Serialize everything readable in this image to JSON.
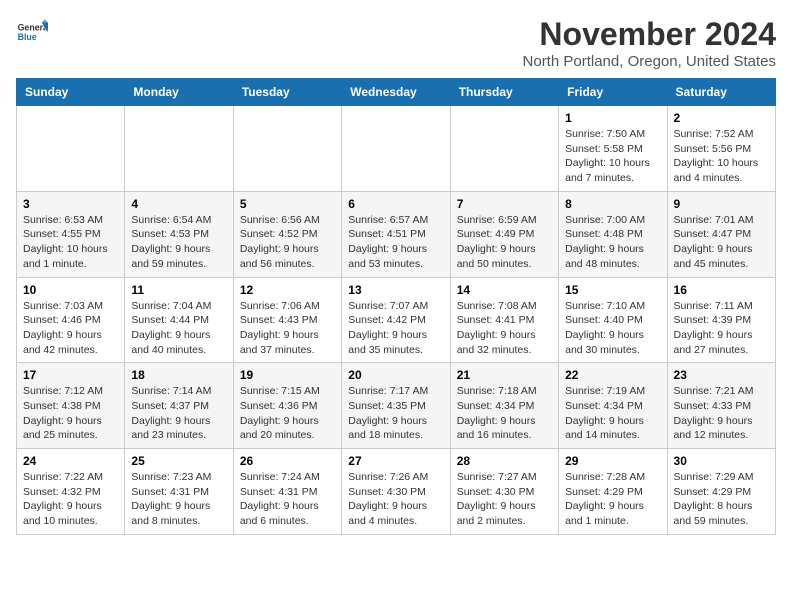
{
  "logo": {
    "line1": "General",
    "line2": "Blue"
  },
  "title": "November 2024",
  "subtitle": "North Portland, Oregon, United States",
  "weekdays": [
    "Sunday",
    "Monday",
    "Tuesday",
    "Wednesday",
    "Thursday",
    "Friday",
    "Saturday"
  ],
  "weeks": [
    [
      {
        "day": "",
        "detail": ""
      },
      {
        "day": "",
        "detail": ""
      },
      {
        "day": "",
        "detail": ""
      },
      {
        "day": "",
        "detail": ""
      },
      {
        "day": "",
        "detail": ""
      },
      {
        "day": "1",
        "detail": "Sunrise: 7:50 AM\nSunset: 5:58 PM\nDaylight: 10 hours and 7 minutes."
      },
      {
        "day": "2",
        "detail": "Sunrise: 7:52 AM\nSunset: 5:56 PM\nDaylight: 10 hours and 4 minutes."
      }
    ],
    [
      {
        "day": "3",
        "detail": "Sunrise: 6:53 AM\nSunset: 4:55 PM\nDaylight: 10 hours and 1 minute."
      },
      {
        "day": "4",
        "detail": "Sunrise: 6:54 AM\nSunset: 4:53 PM\nDaylight: 9 hours and 59 minutes."
      },
      {
        "day": "5",
        "detail": "Sunrise: 6:56 AM\nSunset: 4:52 PM\nDaylight: 9 hours and 56 minutes."
      },
      {
        "day": "6",
        "detail": "Sunrise: 6:57 AM\nSunset: 4:51 PM\nDaylight: 9 hours and 53 minutes."
      },
      {
        "day": "7",
        "detail": "Sunrise: 6:59 AM\nSunset: 4:49 PM\nDaylight: 9 hours and 50 minutes."
      },
      {
        "day": "8",
        "detail": "Sunrise: 7:00 AM\nSunset: 4:48 PM\nDaylight: 9 hours and 48 minutes."
      },
      {
        "day": "9",
        "detail": "Sunrise: 7:01 AM\nSunset: 4:47 PM\nDaylight: 9 hours and 45 minutes."
      }
    ],
    [
      {
        "day": "10",
        "detail": "Sunrise: 7:03 AM\nSunset: 4:46 PM\nDaylight: 9 hours and 42 minutes."
      },
      {
        "day": "11",
        "detail": "Sunrise: 7:04 AM\nSunset: 4:44 PM\nDaylight: 9 hours and 40 minutes."
      },
      {
        "day": "12",
        "detail": "Sunrise: 7:06 AM\nSunset: 4:43 PM\nDaylight: 9 hours and 37 minutes."
      },
      {
        "day": "13",
        "detail": "Sunrise: 7:07 AM\nSunset: 4:42 PM\nDaylight: 9 hours and 35 minutes."
      },
      {
        "day": "14",
        "detail": "Sunrise: 7:08 AM\nSunset: 4:41 PM\nDaylight: 9 hours and 32 minutes."
      },
      {
        "day": "15",
        "detail": "Sunrise: 7:10 AM\nSunset: 4:40 PM\nDaylight: 9 hours and 30 minutes."
      },
      {
        "day": "16",
        "detail": "Sunrise: 7:11 AM\nSunset: 4:39 PM\nDaylight: 9 hours and 27 minutes."
      }
    ],
    [
      {
        "day": "17",
        "detail": "Sunrise: 7:12 AM\nSunset: 4:38 PM\nDaylight: 9 hours and 25 minutes."
      },
      {
        "day": "18",
        "detail": "Sunrise: 7:14 AM\nSunset: 4:37 PM\nDaylight: 9 hours and 23 minutes."
      },
      {
        "day": "19",
        "detail": "Sunrise: 7:15 AM\nSunset: 4:36 PM\nDaylight: 9 hours and 20 minutes."
      },
      {
        "day": "20",
        "detail": "Sunrise: 7:17 AM\nSunset: 4:35 PM\nDaylight: 9 hours and 18 minutes."
      },
      {
        "day": "21",
        "detail": "Sunrise: 7:18 AM\nSunset: 4:34 PM\nDaylight: 9 hours and 16 minutes."
      },
      {
        "day": "22",
        "detail": "Sunrise: 7:19 AM\nSunset: 4:34 PM\nDaylight: 9 hours and 14 minutes."
      },
      {
        "day": "23",
        "detail": "Sunrise: 7:21 AM\nSunset: 4:33 PM\nDaylight: 9 hours and 12 minutes."
      }
    ],
    [
      {
        "day": "24",
        "detail": "Sunrise: 7:22 AM\nSunset: 4:32 PM\nDaylight: 9 hours and 10 minutes."
      },
      {
        "day": "25",
        "detail": "Sunrise: 7:23 AM\nSunset: 4:31 PM\nDaylight: 9 hours and 8 minutes."
      },
      {
        "day": "26",
        "detail": "Sunrise: 7:24 AM\nSunset: 4:31 PM\nDaylight: 9 hours and 6 minutes."
      },
      {
        "day": "27",
        "detail": "Sunrise: 7:26 AM\nSunset: 4:30 PM\nDaylight: 9 hours and 4 minutes."
      },
      {
        "day": "28",
        "detail": "Sunrise: 7:27 AM\nSunset: 4:30 PM\nDaylight: 9 hours and 2 minutes."
      },
      {
        "day": "29",
        "detail": "Sunrise: 7:28 AM\nSunset: 4:29 PM\nDaylight: 9 hours and 1 minute."
      },
      {
        "day": "30",
        "detail": "Sunrise: 7:29 AM\nSunset: 4:29 PM\nDaylight: 8 hours and 59 minutes."
      }
    ]
  ]
}
